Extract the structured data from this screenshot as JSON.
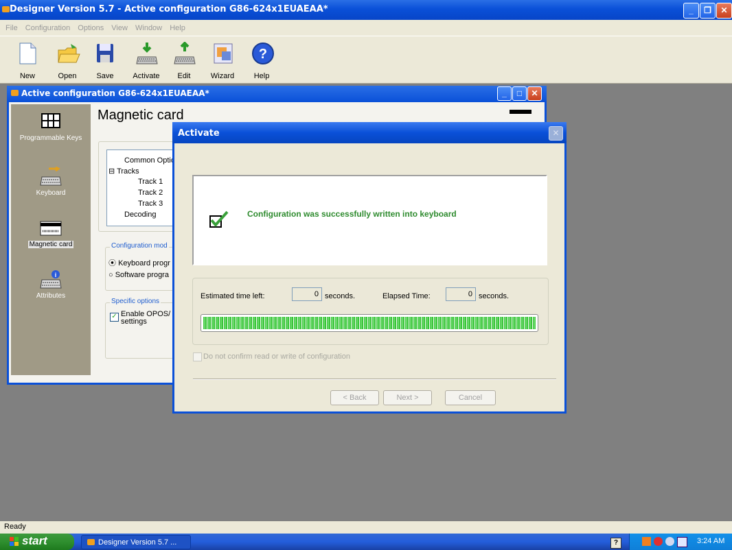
{
  "window": {
    "title": "Designer Version 5.7 - Active configuration G86-624x1EUAEAA*"
  },
  "menu": [
    "File",
    "Configuration",
    "Options",
    "View",
    "Window",
    "Help"
  ],
  "toolbar": {
    "new": "New",
    "open": "Open",
    "save": "Save",
    "activate": "Activate",
    "edit": "Edit",
    "wizard": "Wizard",
    "help": "Help"
  },
  "child": {
    "title": "Active configuration G86-624x1EUAEAA*",
    "nav": {
      "programmable_keys": "Programmable Keys",
      "keyboard": "Keyboard",
      "magnetic_card": "Magnetic card",
      "attributes": "Attributes"
    },
    "panel_title": "Magnetic card",
    "tree": {
      "common": "Common Optio",
      "tracks": "Tracks",
      "track1": "Track 1",
      "track2": "Track 2",
      "track3": "Track 3",
      "decoding": "Decoding"
    },
    "config_mode": {
      "label": "Configuration mod",
      "keyboard": "Keyboard progr",
      "software": "Software progra",
      "selected": "Keyboard progr"
    },
    "specific": {
      "label": "Specific options",
      "enable_line1": "Enable OPOS/",
      "enable_line2": "settings",
      "checked": true
    }
  },
  "dialog": {
    "title": "Activate",
    "message": "Configuration was successfully written into keyboard",
    "estimated_label": "Estimated time left:",
    "estimated_value": "0",
    "elapsed_label": "Elapsed Time:",
    "elapsed_value": "0",
    "seconds": "seconds.",
    "progress": 1.0,
    "checkbox_label": "Do not confirm read or write of configuration",
    "back": "< Back",
    "next": "Next >",
    "cancel": "Cancel"
  },
  "statusbar": {
    "text": "Ready"
  },
  "taskbar": {
    "start": "start",
    "task": "Designer Version 5.7 ...",
    "time": "3:24 AM"
  },
  "colors": {
    "title_blue": "#0a50d8",
    "success_green": "#2e8b2e",
    "progress_green": "#2fc02f"
  }
}
